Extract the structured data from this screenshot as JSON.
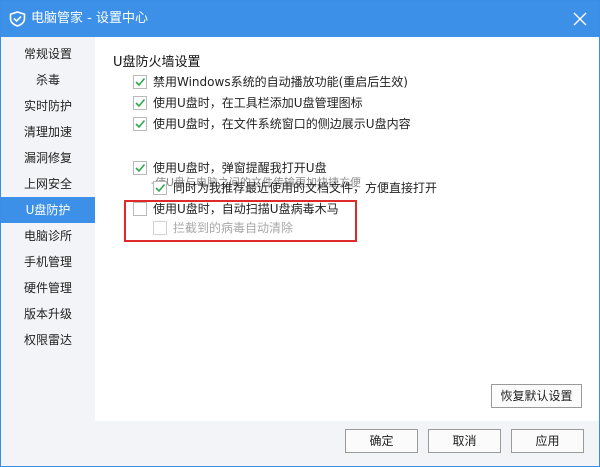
{
  "window": {
    "title": "电脑管家 - 设置中心"
  },
  "sidebar": {
    "items": [
      {
        "label": "常规设置",
        "active": false
      },
      {
        "label": "杀毒",
        "active": false
      },
      {
        "label": "实时防护",
        "active": false
      },
      {
        "label": "清理加速",
        "active": false
      },
      {
        "label": "漏洞修复",
        "active": false
      },
      {
        "label": "上网安全",
        "active": false
      },
      {
        "label": "U盘防护",
        "active": true
      },
      {
        "label": "电脑诊所",
        "active": false
      },
      {
        "label": "手机管理",
        "active": false
      },
      {
        "label": "硬件管理",
        "active": false
      },
      {
        "label": "版本升级",
        "active": false
      },
      {
        "label": "权限雷达",
        "active": false
      }
    ]
  },
  "main": {
    "section_title": "U盘防火墙设置",
    "options": [
      {
        "label": "禁用Windows系统的自动播放功能(重启后生效)",
        "checked": true,
        "disabled": false
      },
      {
        "label": "使用U盘时，在工具栏添加U盘管理图标",
        "checked": true,
        "disabled": false
      },
      {
        "label": "使用U盘时，在文件系统窗口的侧边展示U盘内容",
        "checked": true,
        "disabled": false
      },
      {
        "label": "使用U盘时，弹窗提醒我打开U盘",
        "checked": true,
        "disabled": false
      },
      {
        "label": "同时为我推荐最近使用的文档文件，方便直接打开",
        "checked": true,
        "disabled": false
      },
      {
        "label": "使用U盘时，自动扫描U盘病毒木马",
        "checked": false,
        "disabled": false
      },
      {
        "label": "拦截到的病毒自动清除",
        "checked": false,
        "disabled": true
      }
    ],
    "hint": "-使U盘与电脑之间的文件传输更加快捷方便",
    "restore_label": "恢复默认设置"
  },
  "footer": {
    "ok_label": "确定",
    "cancel_label": "取消",
    "apply_label": "应用"
  },
  "colors": {
    "accent": "#3d90e8",
    "check": "#2fa84f",
    "highlight": "#e02a2a"
  }
}
